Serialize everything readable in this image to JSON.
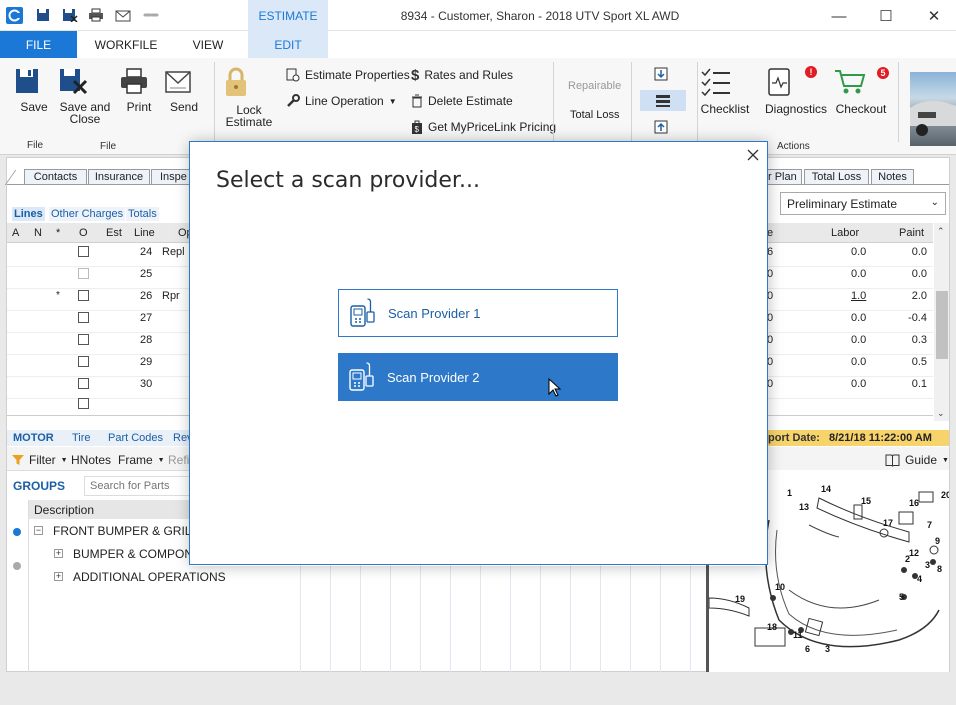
{
  "window": {
    "title": "8934 - Customer, Sharon - 2018 UTV Sport XL AWD",
    "controls": {
      "minimize": "—",
      "maximize": "☐",
      "close": "✕"
    }
  },
  "ribbon_tabs": {
    "file": "FILE",
    "workfile": "WORKFILE",
    "view": "VIEW",
    "estimate_context": "ESTIMATE",
    "edit": "EDIT"
  },
  "ribbon": {
    "save": "Save",
    "save_close_1": "Save and",
    "save_close_2": "Close",
    "print": "Print",
    "send": "Send",
    "lock_1": "Lock",
    "lock_2": "Estimate",
    "estimate_properties": "Estimate Properties",
    "line_operation": "Line Operation",
    "rates_rules": "Rates and Rules",
    "delete_estimate": "Delete Estimate",
    "pricelink": "Get MyPriceLink Pricing",
    "repairable": "Repairable",
    "total_loss": "Total Loss",
    "checklist": "Checklist",
    "diagnostics": "Diagnostics",
    "checkout": "Checkout",
    "checkout_badge": "5",
    "diagnostics_badge": "!",
    "group_file_1": "File",
    "group_file_2": "File",
    "group_actions": "Actions"
  },
  "colors": {
    "accent": "#1b78d6",
    "badge": "#e31b23",
    "highlight": "#f7d36b"
  },
  "subtabs": {
    "contacts": "Contacts",
    "insurance": "Insurance",
    "inspection": "Inspe",
    "repair_plan": "r Plan",
    "total_loss": "Total Loss",
    "notes": "Notes"
  },
  "lines_tabs": {
    "lines": "Lines",
    "other_charges": "Other Charges",
    "totals": "Totals"
  },
  "estimate_type": "Preliminary Estimate",
  "grid": {
    "headers": {
      "a": "A",
      "n": "N",
      "star": "*",
      "o": "O",
      "est": "Est",
      "line": "Line",
      "op": "Op",
      "price": "e",
      "labor": "Labor",
      "paint": "Paint"
    },
    "rows": [
      {
        "star": "",
        "line": "24",
        "op": "Repl",
        "price": "6",
        "labor": "0.0",
        "paint": "0.0"
      },
      {
        "star": "",
        "line": "25",
        "op": "",
        "price": "0",
        "labor": "0.0",
        "paint": "0.0"
      },
      {
        "star": "*",
        "line": "26",
        "op": "Rpr",
        "price": "0",
        "labor": "1.0",
        "paint": "2.0"
      },
      {
        "star": "",
        "line": "27",
        "op": "",
        "price": "0",
        "labor": "0.0",
        "paint": "-0.4"
      },
      {
        "star": "",
        "line": "28",
        "op": "",
        "price": "0",
        "labor": "0.0",
        "paint": "0.3"
      },
      {
        "star": "",
        "line": "29",
        "op": "",
        "price": "0",
        "labor": "0.0",
        "paint": "0.5"
      },
      {
        "star": "",
        "line": "30",
        "op": "",
        "price": "0",
        "labor": "0.0",
        "paint": "0.1"
      }
    ]
  },
  "parts_tabs": {
    "motor": "MOTOR",
    "tire": "Tire",
    "part_codes": "Part Codes",
    "rev": "Rev"
  },
  "parts_toolbar": {
    "filter": "Filter",
    "hnotes": "HNotes",
    "frame": "Frame",
    "refi": "Refi"
  },
  "groups": {
    "label": "GROUPS",
    "search_placeholder": "Search for Parts",
    "description_header": "Description",
    "items": [
      {
        "toggle": "−",
        "label": "FRONT BUMPER & GRILL"
      },
      {
        "toggle": "+",
        "label": "BUMPER & COMPON"
      },
      {
        "toggle": "+",
        "label": "ADDITIONAL OPERATIONS"
      }
    ]
  },
  "report_date": {
    "label": "port Date:",
    "value": "8/21/18 11:22:00 AM"
  },
  "guide": "Guide",
  "diagram_callouts": [
    "1",
    "14",
    "15",
    "16",
    "20",
    "13",
    "17",
    "7",
    "9",
    "12",
    "2",
    "3",
    "8",
    "4",
    "10",
    "5",
    "19",
    "11",
    "18",
    "6",
    "3"
  ],
  "modal": {
    "title": "Select a scan provider...",
    "providers": [
      "Scan Provider 1",
      "Scan Provider 2"
    ]
  }
}
